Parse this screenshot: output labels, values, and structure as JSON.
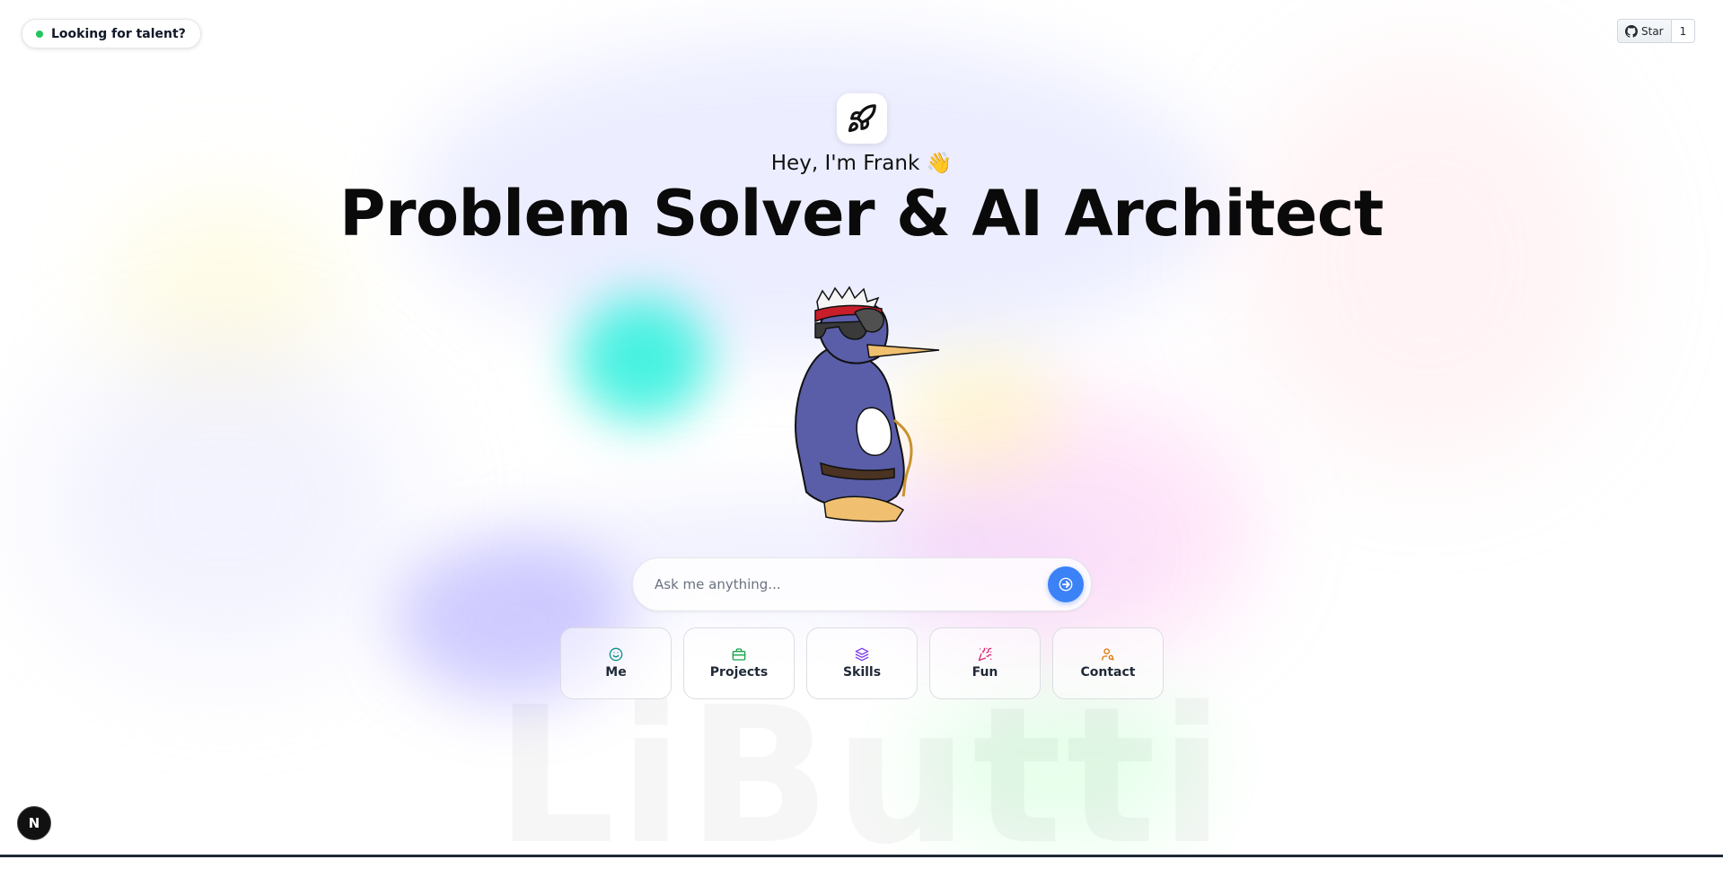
{
  "talent_badge": {
    "label": "Looking for talent?",
    "status_color": "#22c55e"
  },
  "github": {
    "star_label": "Star",
    "count": "1"
  },
  "hero": {
    "greeting": "Hey, I'm Frank",
    "wave_emoji": "👋",
    "headline": "Problem Solver & AI Architect",
    "logo_icon": "rocket-icon",
    "mascot": "penguin-mascot"
  },
  "search": {
    "placeholder": "Ask me anything...",
    "value": "",
    "submit_icon": "arrow-right-icon",
    "accent": "#3b82f6"
  },
  "quick_actions": [
    {
      "label": "Me",
      "icon": "smile-icon",
      "color": "#0d9488"
    },
    {
      "label": "Projects",
      "icon": "briefcase-icon",
      "color": "#16a34a"
    },
    {
      "label": "Skills",
      "icon": "layers-icon",
      "color": "#7c3aed"
    },
    {
      "label": "Fun",
      "icon": "party-popper-icon",
      "color": "#db2777"
    },
    {
      "label": "Contact",
      "icon": "user-search-icon",
      "color": "#d97706"
    }
  ],
  "watermark": "LiButti",
  "next_badge": "N"
}
